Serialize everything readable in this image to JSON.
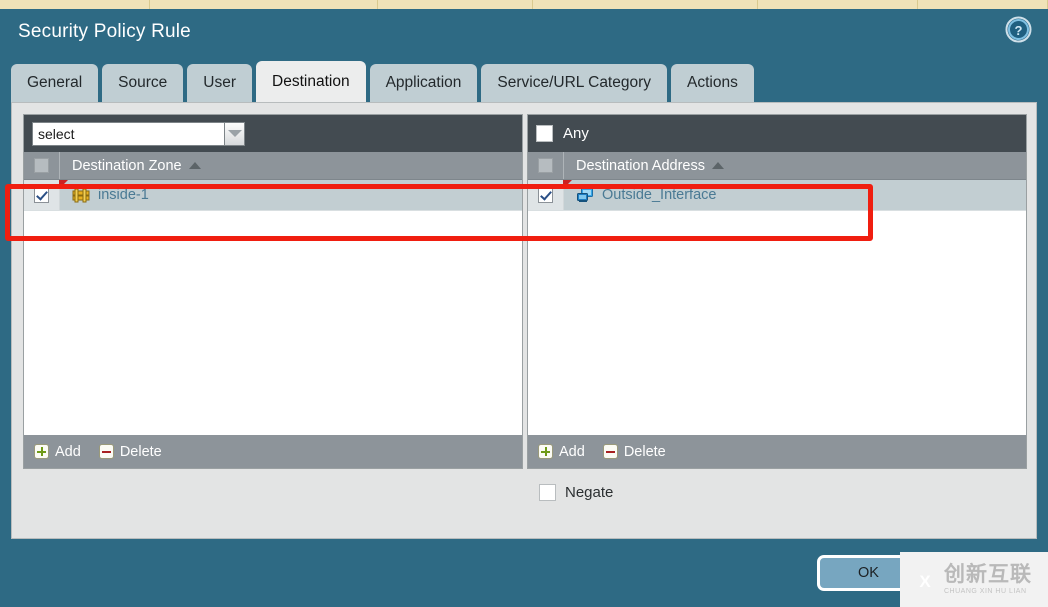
{
  "window": {
    "title": "Security Policy Rule",
    "help_icon": "help-circle-icon"
  },
  "tabs": [
    {
      "label": "General",
      "active": false
    },
    {
      "label": "Source",
      "active": false
    },
    {
      "label": "User",
      "active": false
    },
    {
      "label": "Destination",
      "active": true
    },
    {
      "label": "Application",
      "active": false
    },
    {
      "label": "Service/URL Category",
      "active": false
    },
    {
      "label": "Actions",
      "active": false
    }
  ],
  "destination_zone": {
    "select": {
      "value": "select",
      "placeholder": "select"
    },
    "header": {
      "label": "Destination Zone",
      "sort": "ascending",
      "checkbox_checked": false
    },
    "rows": [
      {
        "label": "inside-1",
        "icon": "zone-icon",
        "checked": true,
        "flagged": true
      }
    ],
    "footer": {
      "add_label": "Add",
      "delete_label": "Delete"
    }
  },
  "destination_address": {
    "any": {
      "label": "Any",
      "checked": false
    },
    "header": {
      "label": "Destination Address",
      "sort": "ascending",
      "checkbox_checked": false
    },
    "rows": [
      {
        "label": "Outside_Interface",
        "icon": "network-computer-icon",
        "checked": true,
        "flagged": true
      }
    ],
    "footer": {
      "add_label": "Add",
      "delete_label": "Delete"
    },
    "negate": {
      "label": "Negate",
      "checked": false
    }
  },
  "buttons": {
    "ok": "OK",
    "cancel": ""
  },
  "watermark": {
    "cn": "创新互联",
    "en": "CHUANG XIN HU LIAN"
  },
  "colors": {
    "dialog_bg": "#2e6a84",
    "tab_inactive": "#c0ced3",
    "tab_active": "#eceded",
    "panel_bg": "#e3e4e4",
    "table_header": "#8d949a",
    "row_selected": "#c2ced2",
    "annotation": "#f01e10",
    "link_text": "#4a7a94",
    "top_strip": "#f0e2b8"
  }
}
